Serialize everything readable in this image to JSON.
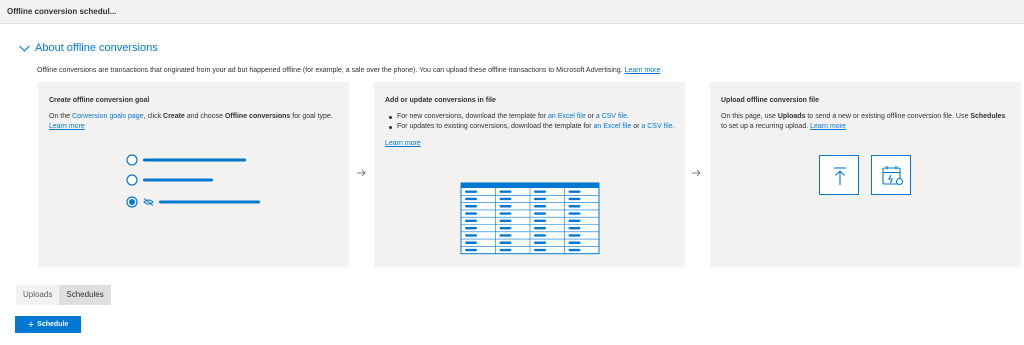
{
  "topbar": {
    "title": "Offline conversion schedul..."
  },
  "section": {
    "title": "About offline conversions",
    "intro_text": "Offline conversions are transactions that originated from your ad but happened offline (for example, a sale over the phone). You can upload these offline transactions to Microsoft Advertising.",
    "intro_link": "Learn more"
  },
  "cards": [
    {
      "title": "Create offline conversion goal",
      "p1": "On the",
      "goals_link": "Conversion goals page",
      "p2": ", click",
      "create_bold": "Create",
      "p3": "and choose",
      "offline_bold": "Offline conversions",
      "p4": "for goal type.",
      "learn_more": "Learn more"
    },
    {
      "title": "Add or update conversions in file",
      "bullet1_a": "For new conversions, download the template for",
      "bullet1_excel": "an Excel file",
      "bullet1_or": "or",
      "bullet1_csv": "a CSV file",
      "bullet1_end": ".",
      "bullet2_a": "For updates to existing conversions, download the template for",
      "bullet2_excel": "an Excel file",
      "bullet2_or": "or",
      "bullet2_csv": "a CSV file",
      "bullet2_end": ".",
      "learn_more": "Learn more"
    },
    {
      "title": "Upload offline conversion file",
      "p1": "On this page, use",
      "uploads_bold": "Uploads",
      "p2": "to send a new or existing offline conversion file. Use",
      "schedules_bold": "Schedules",
      "p3": "to set up a recurring upload.",
      "learn_more": "Learn more"
    }
  ],
  "tabs": [
    {
      "label": "Uploads",
      "active": false
    },
    {
      "label": "Schedules",
      "active": true
    }
  ],
  "schedule_button": {
    "label": "Schedule"
  },
  "colors": {
    "accent": "#0078d4",
    "card_bg": "#f3f2f1",
    "topbar_bg": "#f3f2f1"
  },
  "icons": [
    "chevron-down-icon",
    "arrow-right-icon",
    "upload-icon",
    "schedule-calendar-icon",
    "plus-icon",
    "hidden-eye-icon"
  ]
}
